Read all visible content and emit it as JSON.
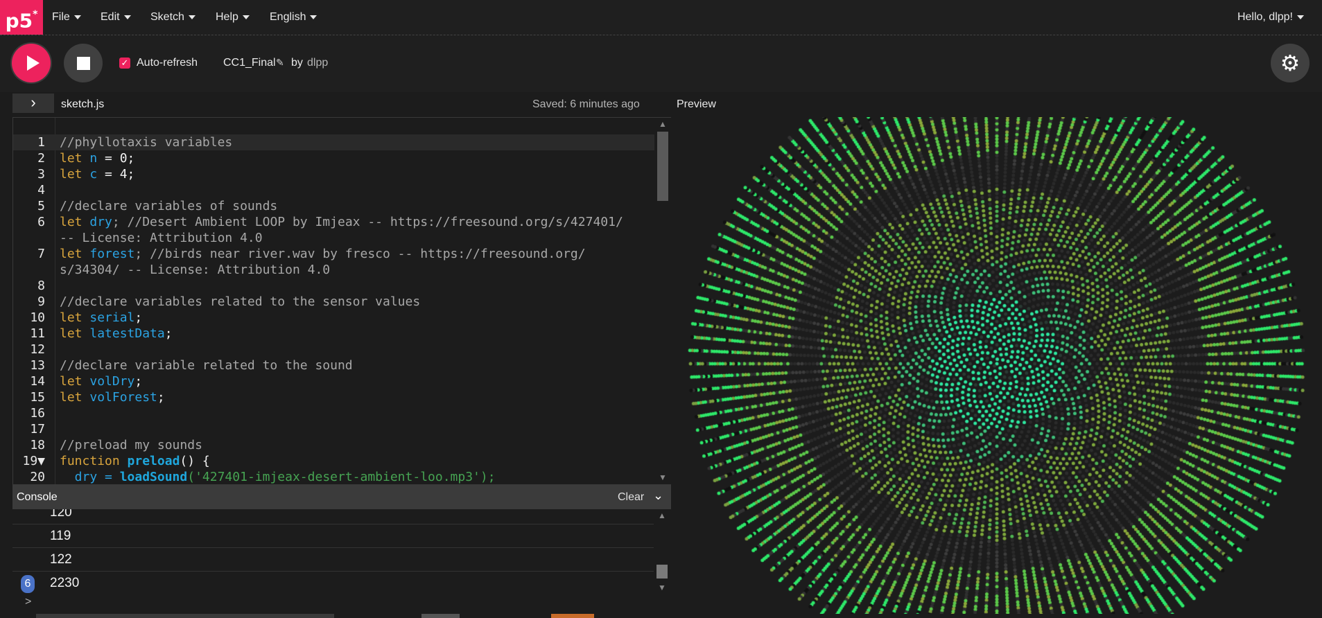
{
  "nav": {
    "logo": "p5",
    "logo_sup": "*",
    "menus": [
      "File",
      "Edit",
      "Sketch",
      "Help",
      "English"
    ],
    "user_greeting": "Hello, dlpp!"
  },
  "toolbar": {
    "auto_refresh_label": "Auto-refresh",
    "auto_refresh_checked": true,
    "sketch_name": "CC1_Final",
    "by_label": "by",
    "author": "dlpp"
  },
  "editor": {
    "filename": "sketch.js",
    "saved_status": "Saved: 6 minutes ago",
    "preview_label": "Preview",
    "lines": [
      {
        "n": "1",
        "tokens": [
          {
            "t": "//phyllotaxis variables",
            "c": "c-comment"
          }
        ],
        "active": true
      },
      {
        "n": "2",
        "tokens": [
          {
            "t": "let ",
            "c": "c-kw"
          },
          {
            "t": "n",
            "c": "c-var"
          },
          {
            "t": " = 0;",
            "c": "c-plain"
          }
        ]
      },
      {
        "n": "3",
        "tokens": [
          {
            "t": "let ",
            "c": "c-kw"
          },
          {
            "t": "c",
            "c": "c-var"
          },
          {
            "t": " = 4;",
            "c": "c-plain"
          }
        ]
      },
      {
        "n": "4",
        "tokens": []
      },
      {
        "n": "5",
        "tokens": [
          {
            "t": "//declare variables of sounds",
            "c": "c-comment"
          }
        ]
      },
      {
        "n": "6",
        "tokens": [
          {
            "t": "let ",
            "c": "c-kw"
          },
          {
            "t": "dry",
            "c": "c-var"
          },
          {
            "t": "; //Desert Ambient LOOP by Imjeax -- https://freesound.org/s/427401/",
            "c": "c-comment"
          }
        ]
      },
      {
        "n": "",
        "tokens": [
          {
            "t": "-- License: Attribution 4.0",
            "c": "c-comment"
          }
        ]
      },
      {
        "n": "7",
        "tokens": [
          {
            "t": "let ",
            "c": "c-kw"
          },
          {
            "t": "forest",
            "c": "c-var"
          },
          {
            "t": "; //birds near river.wav by fresco -- https://freesound.org/",
            "c": "c-comment"
          }
        ]
      },
      {
        "n": "",
        "tokens": [
          {
            "t": "s/34304/ -- License: Attribution 4.0",
            "c": "c-comment"
          }
        ]
      },
      {
        "n": "8",
        "tokens": []
      },
      {
        "n": "9",
        "tokens": [
          {
            "t": "//declare variables related to the sensor values",
            "c": "c-comment"
          }
        ]
      },
      {
        "n": "10",
        "tokens": [
          {
            "t": "let ",
            "c": "c-kw"
          },
          {
            "t": "serial",
            "c": "c-var"
          },
          {
            "t": ";",
            "c": "c-plain"
          }
        ]
      },
      {
        "n": "11",
        "tokens": [
          {
            "t": "let ",
            "c": "c-kw"
          },
          {
            "t": "latestData",
            "c": "c-var"
          },
          {
            "t": ";",
            "c": "c-plain"
          }
        ]
      },
      {
        "n": "12",
        "tokens": []
      },
      {
        "n": "13",
        "tokens": [
          {
            "t": "//declare variable related to the sound",
            "c": "c-comment"
          }
        ]
      },
      {
        "n": "14",
        "tokens": [
          {
            "t": "let ",
            "c": "c-kw"
          },
          {
            "t": "volDry",
            "c": "c-var"
          },
          {
            "t": ";",
            "c": "c-plain"
          }
        ]
      },
      {
        "n": "15",
        "tokens": [
          {
            "t": "let ",
            "c": "c-kw"
          },
          {
            "t": "volForest",
            "c": "c-var"
          },
          {
            "t": ";",
            "c": "c-plain"
          }
        ]
      },
      {
        "n": "16",
        "tokens": []
      },
      {
        "n": "17",
        "tokens": []
      },
      {
        "n": "18",
        "tokens": [
          {
            "t": "//preload my sounds",
            "c": "c-comment"
          }
        ]
      },
      {
        "n": "19▼",
        "tokens": [
          {
            "t": "function ",
            "c": "c-kw"
          },
          {
            "t": "preload",
            "c": "c-fn"
          },
          {
            "t": "() {",
            "c": "c-plain"
          }
        ]
      },
      {
        "n": "20",
        "tokens": [
          {
            "t": "  dry = ",
            "c": "c-var"
          },
          {
            "t": "loadSound",
            "c": "c-fn"
          },
          {
            "t": "('427401-imjeax-desert-ambient-loo.mp3');",
            "c": "c-str"
          }
        ]
      }
    ]
  },
  "console": {
    "title": "Console",
    "clear_label": "Clear",
    "lines": [
      {
        "value": "120",
        "badge": ""
      },
      {
        "value": "119",
        "badge": ""
      },
      {
        "value": "122",
        "badge": ""
      },
      {
        "value": "2230",
        "badge": "6"
      }
    ],
    "prompt": ">"
  },
  "colors": {
    "accent": "#ed225d",
    "background": "#1c1c1c",
    "dot_green": "#2ee86a",
    "dot_olive": "#8aa83a"
  }
}
